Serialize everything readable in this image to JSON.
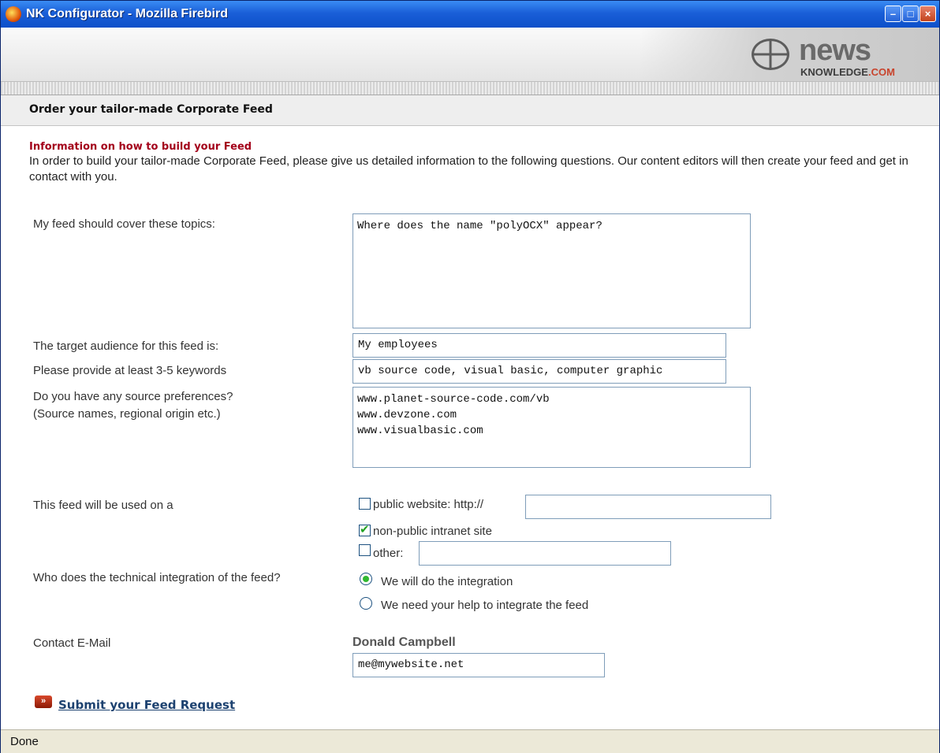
{
  "window": {
    "title": "NK Configurator - Mozilla Firebird"
  },
  "banner": {
    "logo_news": "news",
    "logo_knowledge": "KNOWLEDGE",
    "logo_com": ".COM"
  },
  "page": {
    "heading": "Order your tailor-made Corporate Feed"
  },
  "info": {
    "title": "Information on how to build your Feed",
    "text": "In order to build your tailor-made Corporate Feed, please give us detailed information to the following questions. Our content editors will then create your feed and get in contact with you."
  },
  "form": {
    "topics": {
      "label": "My feed should cover these topics:",
      "value": "Where does the name \"polyOCX\" appear?"
    },
    "audience": {
      "label": "The target audience for this feed is:",
      "value": "My employees"
    },
    "keywords": {
      "label": "Please provide at least 3-5 keywords",
      "value": "vb source code, visual basic, computer graphic"
    },
    "sources": {
      "label_line1": "Do you have any source preferences?",
      "label_line2": "(Source names, regional origin etc.)",
      "value": "www.planet-source-code.com/vb\nwww.devzone.com\nwww.visualbasic.com"
    },
    "usage": {
      "label": "This feed will be used on a",
      "public_label": "public website: http://",
      "public_checked": false,
      "public_value": "",
      "intranet_label": "non-public intranet site",
      "intranet_checked": true,
      "other_label": "other:",
      "other_checked": false,
      "other_value": ""
    },
    "integration": {
      "label": "Who does the technical integration of the feed?",
      "option_self": "We will do the integration",
      "option_help": "We need your help to integrate the feed",
      "selected": "self"
    },
    "contact": {
      "label": "Contact E-Mail",
      "name": "Donald Campbell",
      "email": "me@mywebsite.net"
    }
  },
  "submit": {
    "label": "Submit your Feed Request",
    "icon": "double-chevron-right-icon"
  },
  "status": {
    "text": "Done"
  }
}
